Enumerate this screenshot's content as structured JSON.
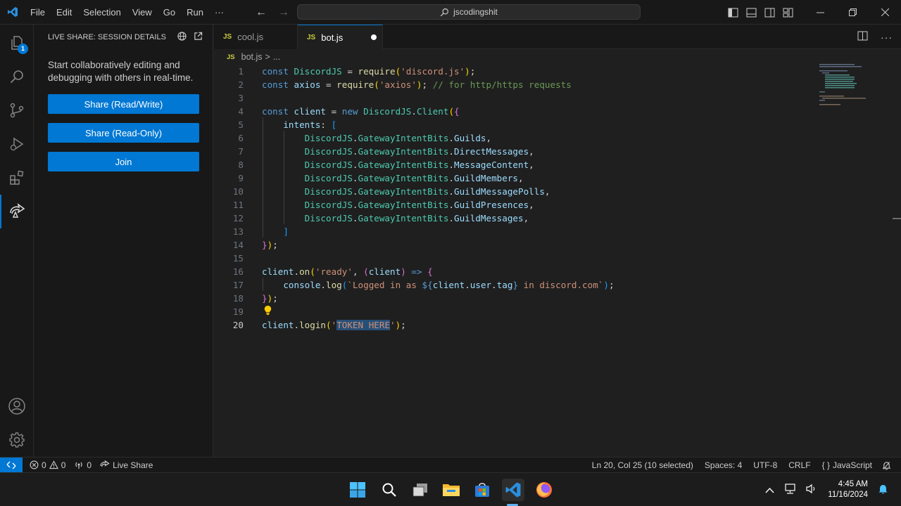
{
  "titlebar": {
    "menu": [
      "File",
      "Edit",
      "Selection",
      "View",
      "Go",
      "Run",
      "···"
    ],
    "search_text": "jscodingshit"
  },
  "activitybar": {
    "explorer_badge": "1"
  },
  "sidebar": {
    "header": "LIVE SHARE: SESSION DETAILS",
    "description": "Start collaboratively editing and debugging with others in real-time.",
    "buttons": [
      "Share (Read/Write)",
      "Share (Read-Only)",
      "Join"
    ]
  },
  "tabs": [
    {
      "icon": "JS",
      "label": "cool.js",
      "active": false
    },
    {
      "icon": "JS",
      "label": "bot.js",
      "active": true,
      "modified": true
    }
  ],
  "breadcrumb": {
    "icon": "JS",
    "file": "bot.js",
    "separator": ">",
    "rest": "..."
  },
  "editor": {
    "current_line": 20,
    "selected_text": "TOKEN HERE",
    "lines": [
      {
        "n": "1",
        "tokens": [
          [
            "kw",
            "const "
          ],
          [
            "cls",
            "DiscordJS"
          ],
          [
            "pl",
            " = "
          ],
          [
            "fn",
            "require"
          ],
          [
            "br1",
            "("
          ],
          [
            "str",
            "'discord.js'"
          ],
          [
            "br1",
            ")"
          ],
          [
            "pl",
            ";"
          ]
        ]
      },
      {
        "n": "2",
        "tokens": [
          [
            "kw",
            "const "
          ],
          [
            "var",
            "axios"
          ],
          [
            "pl",
            " = "
          ],
          [
            "fn",
            "require"
          ],
          [
            "br1",
            "("
          ],
          [
            "str",
            "'axios'"
          ],
          [
            "br1",
            ")"
          ],
          [
            "pl",
            "; "
          ],
          [
            "cmt",
            "// for http/https requests"
          ]
        ]
      },
      {
        "n": "3",
        "tokens": []
      },
      {
        "n": "4",
        "tokens": [
          [
            "kw",
            "const "
          ],
          [
            "var",
            "client"
          ],
          [
            "pl",
            " = "
          ],
          [
            "kw",
            "new "
          ],
          [
            "cls",
            "DiscordJS"
          ],
          [
            "pl",
            "."
          ],
          [
            "cls",
            "Client"
          ],
          [
            "br1",
            "("
          ],
          [
            "br2",
            "{"
          ]
        ]
      },
      {
        "n": "5",
        "tokens": [
          [
            "pl",
            "    "
          ],
          [
            "var",
            "intents"
          ],
          [
            "pl",
            ": "
          ],
          [
            "br3",
            "["
          ]
        ]
      },
      {
        "n": "6",
        "tokens": [
          [
            "pl",
            "        "
          ],
          [
            "cls",
            "DiscordJS"
          ],
          [
            "pl",
            "."
          ],
          [
            "cls",
            "GatewayIntentBits"
          ],
          [
            "pl",
            "."
          ],
          [
            "var",
            "Guilds"
          ],
          [
            "pl",
            ","
          ]
        ]
      },
      {
        "n": "7",
        "tokens": [
          [
            "pl",
            "        "
          ],
          [
            "cls",
            "DiscordJS"
          ],
          [
            "pl",
            "."
          ],
          [
            "cls",
            "GatewayIntentBits"
          ],
          [
            "pl",
            "."
          ],
          [
            "var",
            "DirectMessages"
          ],
          [
            "pl",
            ","
          ]
        ]
      },
      {
        "n": "8",
        "tokens": [
          [
            "pl",
            "        "
          ],
          [
            "cls",
            "DiscordJS"
          ],
          [
            "pl",
            "."
          ],
          [
            "cls",
            "GatewayIntentBits"
          ],
          [
            "pl",
            "."
          ],
          [
            "var",
            "MessageContent"
          ],
          [
            "pl",
            ","
          ]
        ]
      },
      {
        "n": "9",
        "tokens": [
          [
            "pl",
            "        "
          ],
          [
            "cls",
            "DiscordJS"
          ],
          [
            "pl",
            "."
          ],
          [
            "cls",
            "GatewayIntentBits"
          ],
          [
            "pl",
            "."
          ],
          [
            "var",
            "GuildMembers"
          ],
          [
            "pl",
            ","
          ]
        ]
      },
      {
        "n": "10",
        "tokens": [
          [
            "pl",
            "        "
          ],
          [
            "cls",
            "DiscordJS"
          ],
          [
            "pl",
            "."
          ],
          [
            "cls",
            "GatewayIntentBits"
          ],
          [
            "pl",
            "."
          ],
          [
            "var",
            "GuildMessagePolls"
          ],
          [
            "pl",
            ","
          ]
        ]
      },
      {
        "n": "11",
        "tokens": [
          [
            "pl",
            "        "
          ],
          [
            "cls",
            "DiscordJS"
          ],
          [
            "pl",
            "."
          ],
          [
            "cls",
            "GatewayIntentBits"
          ],
          [
            "pl",
            "."
          ],
          [
            "var",
            "GuildPresences"
          ],
          [
            "pl",
            ","
          ]
        ]
      },
      {
        "n": "12",
        "tokens": [
          [
            "pl",
            "        "
          ],
          [
            "cls",
            "DiscordJS"
          ],
          [
            "pl",
            "."
          ],
          [
            "cls",
            "GatewayIntentBits"
          ],
          [
            "pl",
            "."
          ],
          [
            "var",
            "GuildMessages"
          ],
          [
            "pl",
            ","
          ]
        ]
      },
      {
        "n": "13",
        "tokens": [
          [
            "pl",
            "    "
          ],
          [
            "br3",
            "]"
          ]
        ]
      },
      {
        "n": "14",
        "tokens": [
          [
            "br2",
            "}"
          ],
          [
            "br1",
            ")"
          ],
          [
            "pl",
            ";"
          ]
        ]
      },
      {
        "n": "15",
        "tokens": []
      },
      {
        "n": "16",
        "tokens": [
          [
            "var",
            "client"
          ],
          [
            "pl",
            "."
          ],
          [
            "fn",
            "on"
          ],
          [
            "br1",
            "("
          ],
          [
            "str",
            "'ready'"
          ],
          [
            "pl",
            ", "
          ],
          [
            "br2",
            "("
          ],
          [
            "var",
            "client"
          ],
          [
            "br2",
            ")"
          ],
          [
            "pl",
            " "
          ],
          [
            "kw",
            "=>"
          ],
          [
            "pl",
            " "
          ],
          [
            "br2",
            "{"
          ]
        ]
      },
      {
        "n": "17",
        "tokens": [
          [
            "pl",
            "    "
          ],
          [
            "var",
            "console"
          ],
          [
            "pl",
            "."
          ],
          [
            "fn",
            "log"
          ],
          [
            "br3",
            "("
          ],
          [
            "str",
            "`Logged in as "
          ],
          [
            "kw",
            "${"
          ],
          [
            "var",
            "client"
          ],
          [
            "pl",
            "."
          ],
          [
            "var",
            "user"
          ],
          [
            "pl",
            "."
          ],
          [
            "var",
            "tag"
          ],
          [
            "kw",
            "}"
          ],
          [
            "str",
            " in discord.com`"
          ],
          [
            "br3",
            ")"
          ],
          [
            "pl",
            ";"
          ]
        ]
      },
      {
        "n": "18",
        "tokens": [
          [
            "br2",
            "}"
          ],
          [
            "br1",
            ")"
          ],
          [
            "pl",
            ";"
          ]
        ]
      },
      {
        "n": "19",
        "tokens": []
      },
      {
        "n": "20",
        "tokens": [
          [
            "var",
            "client"
          ],
          [
            "pl",
            "."
          ],
          [
            "fn",
            "login"
          ],
          [
            "br1",
            "("
          ],
          [
            "str",
            "'"
          ],
          [
            "sel",
            "TOKEN HERE"
          ],
          [
            "str",
            "'"
          ],
          [
            "br1",
            ")"
          ],
          [
            "pl",
            ";"
          ]
        ]
      }
    ]
  },
  "statusbar": {
    "errors": "0",
    "warnings": "0",
    "ports": "0",
    "live_share": "Live Share",
    "cursor": "Ln 20, Col 25 (10 selected)",
    "spaces": "Spaces: 4",
    "encoding": "UTF-8",
    "eol": "CRLF",
    "language_icon": "{ }",
    "language": "JavaScript"
  },
  "taskbar": {
    "time": "4:45 AM",
    "date": "11/16/2024"
  },
  "colors": {
    "accent": "#0078d4",
    "background": "#1f1f1f",
    "chrome": "#181818"
  }
}
